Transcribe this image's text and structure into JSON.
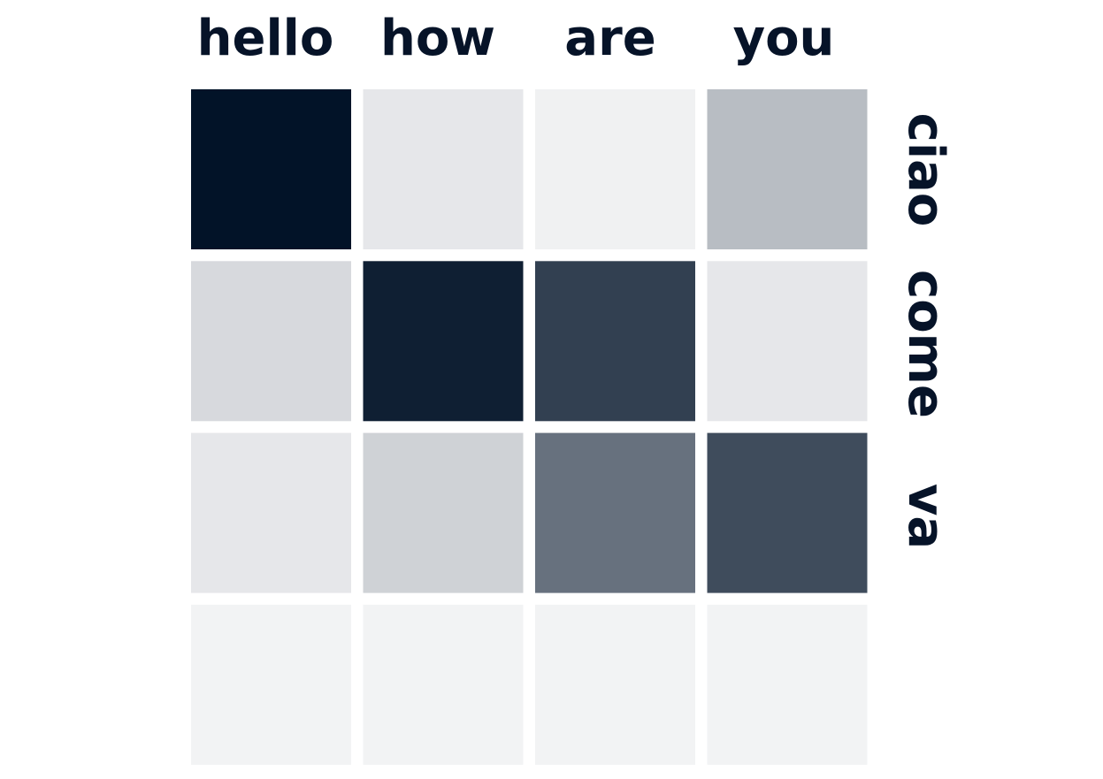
{
  "chart_data": {
    "type": "heatmap",
    "x_labels": [
      "hello",
      "how",
      "are",
      "you"
    ],
    "y_labels": [
      "ciao",
      "come",
      "va",
      ""
    ],
    "values": [
      [
        1.0,
        0.1,
        0.06,
        0.28
      ],
      [
        0.16,
        0.95,
        0.81,
        0.1
      ],
      [
        0.1,
        0.19,
        0.6,
        0.76
      ],
      [
        0.05,
        0.05,
        0.05,
        0.05
      ]
    ],
    "color_low": "#ffffff",
    "color_high": "#021328",
    "label_color": "#061328"
  }
}
